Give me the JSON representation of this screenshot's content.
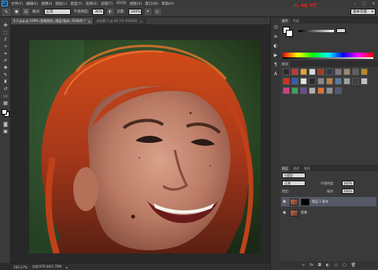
{
  "app": {
    "logo": "Ps"
  },
  "menubar": {
    "items": [
      "文件(F)",
      "编辑(E)",
      "图像(I)",
      "图层(L)",
      "类型(Y)",
      "选择(S)",
      "滤镜(T)",
      "3D(D)",
      "视图(V)",
      "窗口(W)",
      "帮助(H)"
    ],
    "window_controls": [
      "–",
      "▢",
      "✕"
    ]
  },
  "options": {
    "mode_label": "模式:",
    "mode_value": "正常",
    "opacity_label": "不透明度:",
    "opacity_value": "36%",
    "flow_label": "流量:",
    "flow_value": "100%",
    "workspace": "基本功能"
  },
  "watermark": {
    "prefix": "ug",
    "text": "小技巧"
  },
  "tabs": [
    {
      "label": "5-2.jpg @ 100% (智能锐化, 图层2副本, RGB/8) *",
      "active": true
    },
    {
      "label": "未标题-1 @ 66.7% (RGB/8)",
      "active": false
    }
  ],
  "status": {
    "zoom": "100.27%",
    "doc": "文档:976.4K/1.76M"
  },
  "panels": {
    "color_tabs": [
      "颜色",
      "色板"
    ],
    "swatch_tabs": [
      "色板"
    ],
    "style_tabs": [
      "样式"
    ],
    "layers_tabs": [
      "图层",
      "通道",
      "路径"
    ],
    "layers_filter_label": "类型",
    "blend_mode": "正常",
    "opacity_label": "不透明度:",
    "opacity_value": "100%",
    "lock_label": "锁定:",
    "fill_label": "填充:",
    "fill_value": "100%",
    "layers": [
      {
        "name": "图层 1 副本",
        "selected": true,
        "black_mask": true
      },
      {
        "name": "背景",
        "selected": false,
        "black_mask": false
      }
    ]
  },
  "colors": {
    "accent": "#31a8ff",
    "watermark": "#e0201a",
    "selected_layer": "#555a66"
  }
}
